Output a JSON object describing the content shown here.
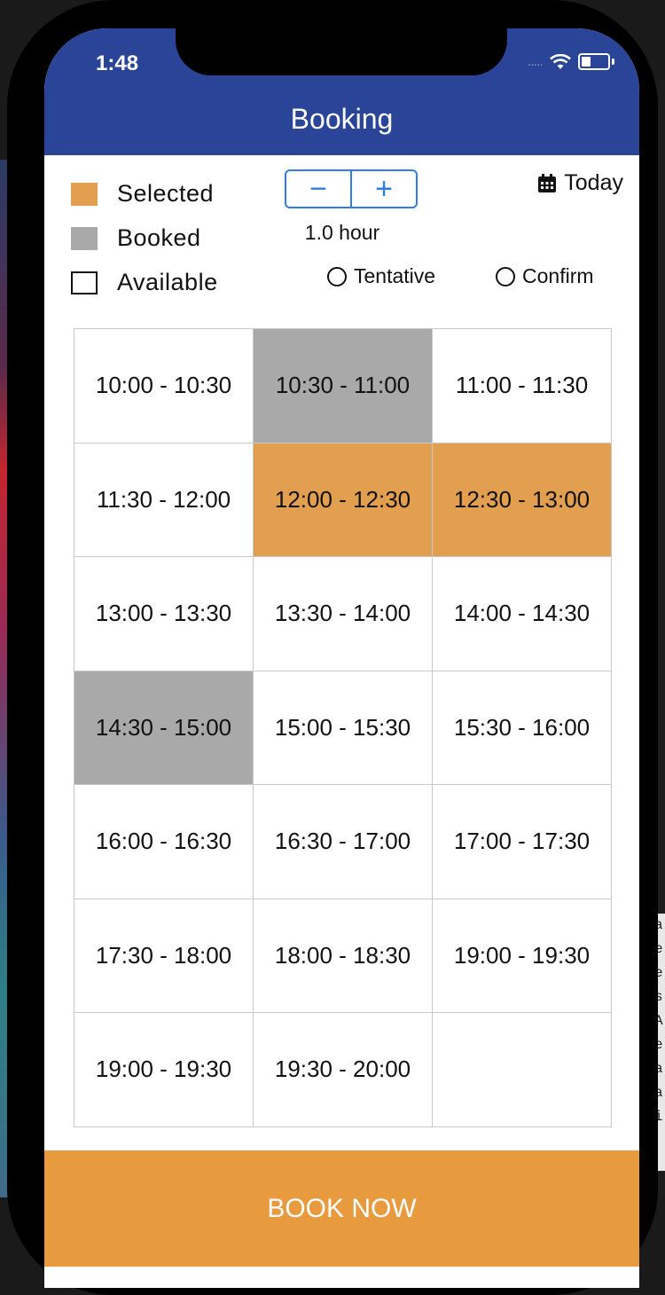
{
  "status_bar": {
    "time": "1:48",
    "signal": "....."
  },
  "header": {
    "title": "Booking"
  },
  "legend": [
    {
      "label": "Selected",
      "color": "#e19f4f"
    },
    {
      "label": "Booked",
      "color": "#a9a9a9"
    },
    {
      "label": "Available",
      "color": "#ffffff"
    }
  ],
  "stepper": {
    "minus": "−",
    "plus": "+",
    "duration": "1.0 hour"
  },
  "today": {
    "icon": "calendar-icon",
    "label": "Today"
  },
  "status_options": [
    {
      "label": "Tentative"
    },
    {
      "label": "Confirm"
    }
  ],
  "slots": [
    {
      "label": "10:00 - 10:30",
      "state": "available"
    },
    {
      "label": "10:30 - 11:00",
      "state": "booked"
    },
    {
      "label": "11:00 - 11:30",
      "state": "available"
    },
    {
      "label": "11:30 - 12:00",
      "state": "available"
    },
    {
      "label": "12:00 - 12:30",
      "state": "selected"
    },
    {
      "label": "12:30 - 13:00",
      "state": "selected"
    },
    {
      "label": "13:00 - 13:30",
      "state": "available"
    },
    {
      "label": "13:30 - 14:00",
      "state": "available"
    },
    {
      "label": "14:00 - 14:30",
      "state": "available"
    },
    {
      "label": "14:30 - 15:00",
      "state": "booked"
    },
    {
      "label": "15:00 - 15:30",
      "state": "available"
    },
    {
      "label": "15:30 - 16:00",
      "state": "available"
    },
    {
      "label": "16:00 - 16:30",
      "state": "available"
    },
    {
      "label": "16:30 - 17:00",
      "state": "available"
    },
    {
      "label": "17:00 - 17:30",
      "state": "available"
    },
    {
      "label": "17:30 - 18:00",
      "state": "available"
    },
    {
      "label": "18:00 - 18:30",
      "state": "available"
    },
    {
      "label": "19:00 - 19:30",
      "state": "available"
    },
    {
      "label": "19:00 - 19:30",
      "state": "available"
    },
    {
      "label": "19:30 - 20:00",
      "state": "available"
    },
    {
      "label": "",
      "state": "empty"
    }
  ],
  "book_button": {
    "label": "BOOK NOW",
    "color": "#e89a3f"
  },
  "desktop_strip_text": [
    "a",
    "e",
    "e",
    "s",
    "A",
    "e",
    "a",
    "a",
    "i"
  ]
}
